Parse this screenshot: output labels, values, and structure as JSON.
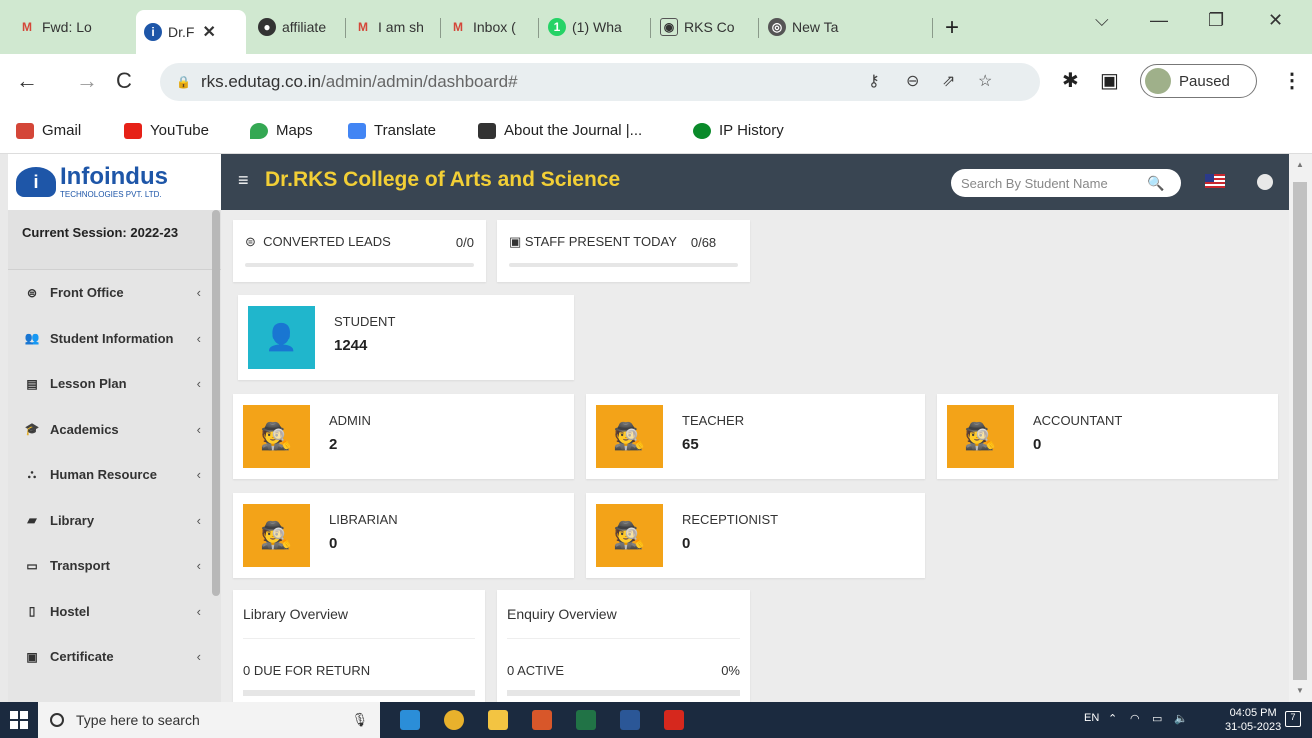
{
  "browser": {
    "tabs": [
      {
        "label": "Fwd: Lo",
        "icon": "gmail-icon",
        "color": "#d44638"
      },
      {
        "label": "Dr.F",
        "icon": "infoindus-icon",
        "color": "#1e56a8",
        "active": true
      },
      {
        "label": "affiliate",
        "icon": "globe-icon",
        "color": "#333333"
      },
      {
        "label": "I am sh",
        "icon": "gmail-icon",
        "color": "#d44638"
      },
      {
        "label": "Inbox (",
        "icon": "gmail-icon",
        "color": "#d44638"
      },
      {
        "label": "(1) Wha",
        "icon": "whatsapp-icon",
        "color": "#25d366"
      },
      {
        "label": "RKS Co",
        "icon": "rks-icon",
        "color": "#555555"
      },
      {
        "label": "New Ta",
        "icon": "chrome-icon",
        "color": "#555555"
      }
    ],
    "new_tab_glyph": "+",
    "url_host": "rks.edutag.co.in",
    "url_path": "/admin/admin/dashboard#",
    "profile_status": "Paused",
    "bookmarks": [
      {
        "label": "Gmail",
        "color": "#d44638"
      },
      {
        "label": "YouTube",
        "color": "#e62117"
      },
      {
        "label": "Maps",
        "color": "#34a853"
      },
      {
        "label": "Translate",
        "color": "#4285f4"
      },
      {
        "label": "About the Journal |...",
        "color": "#333333"
      },
      {
        "label": "IP History",
        "color": "#0a8a2a"
      }
    ]
  },
  "app": {
    "logo_brand": "Infoindus",
    "logo_sub": "TECHNOLOGIES PVT. LTD.",
    "college_name": "Dr.RKS College of Arts and Science",
    "search_placeholder": "Search By Student Name",
    "session_label": "Current Session: 2022-23",
    "menu": [
      {
        "label": "Front Office",
        "icon": "front-office-icon",
        "glyph": "⊜"
      },
      {
        "label": "Student Information",
        "icon": "student-info-icon",
        "glyph": "👥"
      },
      {
        "label": "Lesson Plan",
        "icon": "lesson-plan-icon",
        "glyph": "▤"
      },
      {
        "label": "Academics",
        "icon": "academics-icon",
        "glyph": "🎓"
      },
      {
        "label": "Human Resource",
        "icon": "human-resource-icon",
        "glyph": "⛬"
      },
      {
        "label": "Library",
        "icon": "library-icon",
        "glyph": "▰"
      },
      {
        "label": "Transport",
        "icon": "transport-icon",
        "glyph": "▭"
      },
      {
        "label": "Hostel",
        "icon": "hostel-icon",
        "glyph": "▯"
      },
      {
        "label": "Certificate",
        "icon": "certificate-icon",
        "glyph": "▣"
      }
    ],
    "progress_cards": [
      {
        "label": "CONVERTED LEADS",
        "value": "0/0",
        "icon": "leads-icon"
      },
      {
        "label": "STAFF PRESENT TODAY",
        "value": "0/68",
        "icon": "calendar-icon"
      }
    ],
    "student_card": {
      "label": "STUDENT",
      "value": "1244"
    },
    "staff_cards": [
      {
        "label": "ADMIN",
        "value": "2"
      },
      {
        "label": "TEACHER",
        "value": "65"
      },
      {
        "label": "ACCOUNTANT",
        "value": "0"
      },
      {
        "label": "LIBRARIAN",
        "value": "0"
      },
      {
        "label": "RECEPTIONIST",
        "value": "0"
      }
    ],
    "overview_cards": [
      {
        "title": "Library Overview",
        "value": "0 DUE FOR RETURN",
        "percent": ""
      },
      {
        "title": "Enquiry Overview",
        "value": "0 ACTIVE",
        "percent": "0%"
      }
    ],
    "colors": {
      "accent_teal": "#20b6cc",
      "accent_orange": "#f3a318",
      "header": "#394552",
      "title_yellow": "#f2cf36"
    }
  },
  "taskbar": {
    "search_placeholder": "Type here to search",
    "lang": "EN",
    "time": "04:05 PM",
    "date": "31-05-2023",
    "notifications": "7"
  }
}
